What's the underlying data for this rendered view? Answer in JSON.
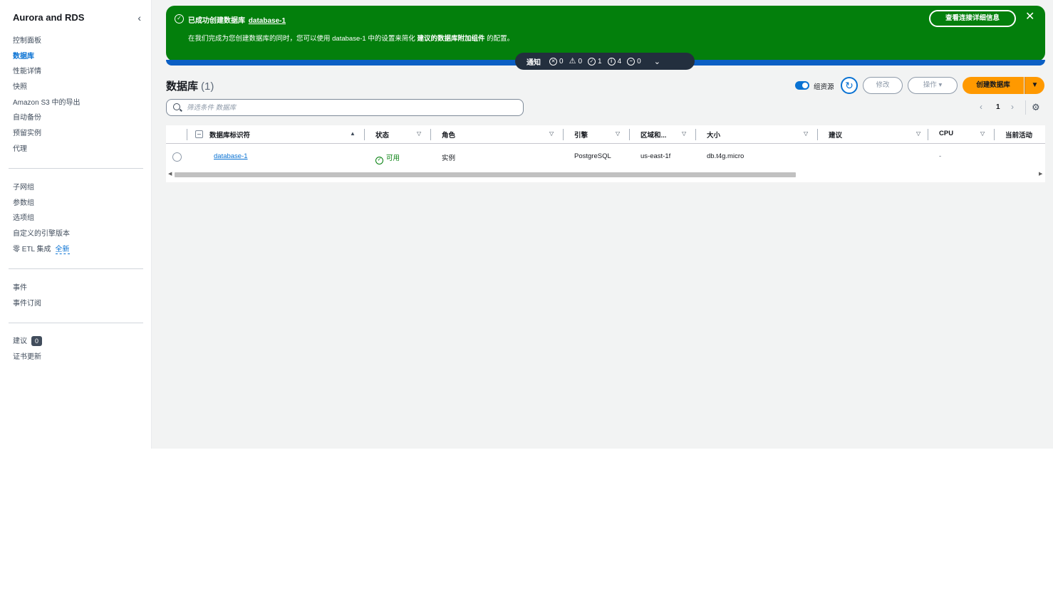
{
  "sidebar": {
    "title": "Aurora and RDS",
    "group1": [
      "控制面板",
      "数据库",
      "性能详情",
      "快照",
      "Amazon S3 中的导出",
      "自动备份",
      "预留实例",
      "代理"
    ],
    "group2": [
      "子网组",
      "参数组",
      "选项组",
      "自定义的引擎版本",
      "零 ETL 集成"
    ],
    "new_badge": "全新",
    "group3": [
      "事件",
      "事件订阅"
    ],
    "recommendations": "建议",
    "recommendations_count": "0",
    "cert_update": "证书更新"
  },
  "flash": {
    "title_prefix": "已成功创建数据库",
    "title_db": "database-1",
    "desc_part1": "在我们完成为您创建数据库的同时，您可以使用 database-1 中的设置来简化",
    "desc_bold": "建议的数据库附加组件",
    "desc_part2": "的配置。",
    "button": "查看连接详细信息"
  },
  "notifications": {
    "label": "通知",
    "error": "0",
    "warning": "0",
    "success": "1",
    "info": "4",
    "in_progress": "0"
  },
  "header": {
    "title": "数据库",
    "count": "(1)",
    "toggle_label": "组资源",
    "modify": "修改",
    "actions": "操作",
    "create": "创建数据库"
  },
  "search": {
    "placeholder": "筛选条件 数据库"
  },
  "pagination": {
    "page": "1"
  },
  "table": {
    "columns": [
      "数据库标识符",
      "状态",
      "角色",
      "引擎",
      "区域和...",
      "大小",
      "建议",
      "CPU",
      "当前活动"
    ],
    "rows": [
      {
        "id": "database-1",
        "status": "可用",
        "role": "实例",
        "engine": "PostgreSQL",
        "region": "us-east-1f",
        "size": "db.t4g.micro",
        "recommendation": "",
        "cpu": "-",
        "activity": ""
      }
    ]
  },
  "colors": {
    "success_green": "#037f0c",
    "link_blue": "#0972d3",
    "primary_orange": "#ff9900",
    "dark_navy": "#232f3e"
  }
}
